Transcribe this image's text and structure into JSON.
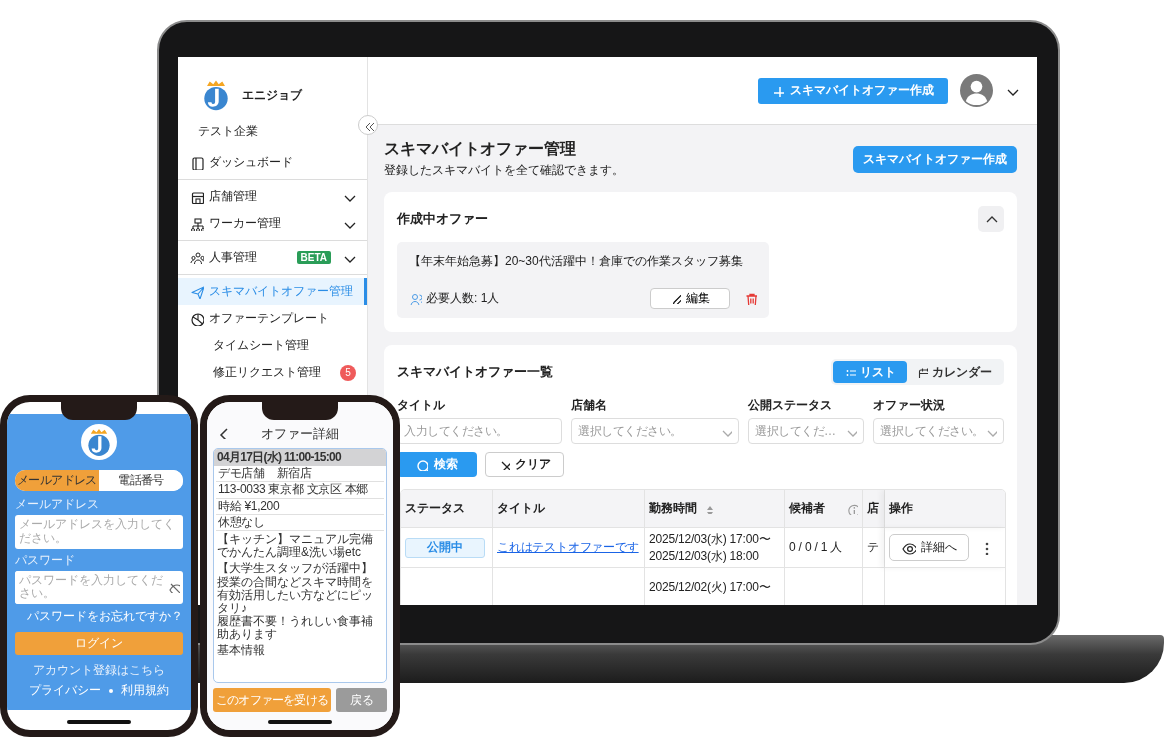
{
  "laptop": {
    "sidebar": {
      "brand": "エニジョブ",
      "company": "テスト企業",
      "groups": [
        {
          "items": [
            {
              "label": "ダッシュボード",
              "selected": false
            }
          ]
        },
        {
          "items": [
            {
              "label": "店舗管理",
              "selected": false,
              "expanded": false
            },
            {
              "label": "ワーカー管理",
              "selected": false,
              "expanded": false
            }
          ]
        },
        {
          "items": [
            {
              "label": "人事管理",
              "selected": false,
              "expanded": false,
              "badge": "BETA"
            }
          ]
        },
        {
          "items": [
            {
              "label": "スキマバイトオファー管理",
              "selected": true
            },
            {
              "label": "オファーテンプレート",
              "selected": false
            },
            {
              "label": "タイムシート管理",
              "selected": false
            },
            {
              "label": "修正リクエスト管理",
              "selected": false,
              "count": "5"
            }
          ]
        }
      ]
    },
    "header": {
      "create_button": "スキマバイトオファー作成"
    },
    "page": {
      "title": "スキマバイトオファー管理",
      "subtitle": "登録したスキマバイトを全て確認できます。",
      "create_button": "スキマバイトオファー作成"
    },
    "drafts": {
      "title": "作成中オファー",
      "expanded": true,
      "offers": [
        {
          "title": "【年末年始急募】20~30代活躍中！倉庫での作業スタッフ募集",
          "required": "必要人数: 1人",
          "edit": "編集"
        }
      ]
    },
    "list": {
      "title": "スキマバイトオファー一覧",
      "views": [
        {
          "label": "リスト",
          "selected": true
        },
        {
          "label": "カレンダー",
          "selected": false
        }
      ],
      "filters": [
        {
          "label": "タイトル",
          "placeholder": "入力してください。",
          "kind": "text"
        },
        {
          "label": "店舗名",
          "placeholder": "選択してください。",
          "kind": "select"
        },
        {
          "label": "公開ステータス",
          "placeholder": "選択してくだ…",
          "kind": "select"
        },
        {
          "label": "オファー状況",
          "placeholder": "選択してください。",
          "kind": "select"
        }
      ],
      "search_button": "検索",
      "clear_button": "クリア",
      "columns": [
        {
          "label": "ステータス"
        },
        {
          "label": "タイトル"
        },
        {
          "label": "勤務時間",
          "sortable": true
        },
        {
          "label": "候補者",
          "info": true
        },
        {
          "label": "店"
        },
        {
          "label": "操作"
        }
      ],
      "rows": [
        {
          "status": "公開中",
          "title": "これはテストオファーです",
          "time": [
            "2025/12/03(水) 17:00〜",
            "2025/12/03(水) 18:00"
          ],
          "candidates": "0 / 0 / 1 人",
          "store": "テ",
          "action": "詳細へ"
        },
        {
          "time": [
            "2025/12/02(火) 17:00〜"
          ]
        }
      ]
    }
  },
  "login_phone": {
    "tabs": [
      {
        "label": "メールアドレス",
        "selected": true
      },
      {
        "label": "電話番号",
        "selected": false
      }
    ],
    "fields": [
      {
        "label": "メールアドレス",
        "placeholder": "メールアドレスを入力してください。",
        "kind": "text"
      },
      {
        "label": "パスワード",
        "placeholder": "パスワードを入力してください。",
        "kind": "password"
      }
    ],
    "forgot": "パスワードをお忘れですか？",
    "login_button": "ログイン",
    "signup": "アカウント登録はこちら",
    "footer_links": [
      "プライバシー",
      "利用規約"
    ]
  },
  "detail_phone": {
    "title": "オファー詳細",
    "date": "04月17日(水) 11:00-15:00",
    "rows": [
      "デモ店舗　新宿店",
      "113-0033 東京都 文京区 本郷",
      "時給 ¥1,200",
      "休憩なし"
    ],
    "description": [
      [
        "【キッチン】マニュアル完備でかんたん調理&洗い場etc"
      ],
      [
        "【大学生スタッフが活躍中】",
        "授業の合間などスキマ時間を有効活用したい方などにピッタリ♪",
        "履歴書不要！うれしい食事補助あります"
      ],
      [
        "基本情報"
      ]
    ],
    "buttons": [
      {
        "label": "このオファーを受ける",
        "kind": "primary"
      },
      {
        "label": "戻る",
        "kind": "secondary"
      }
    ]
  }
}
